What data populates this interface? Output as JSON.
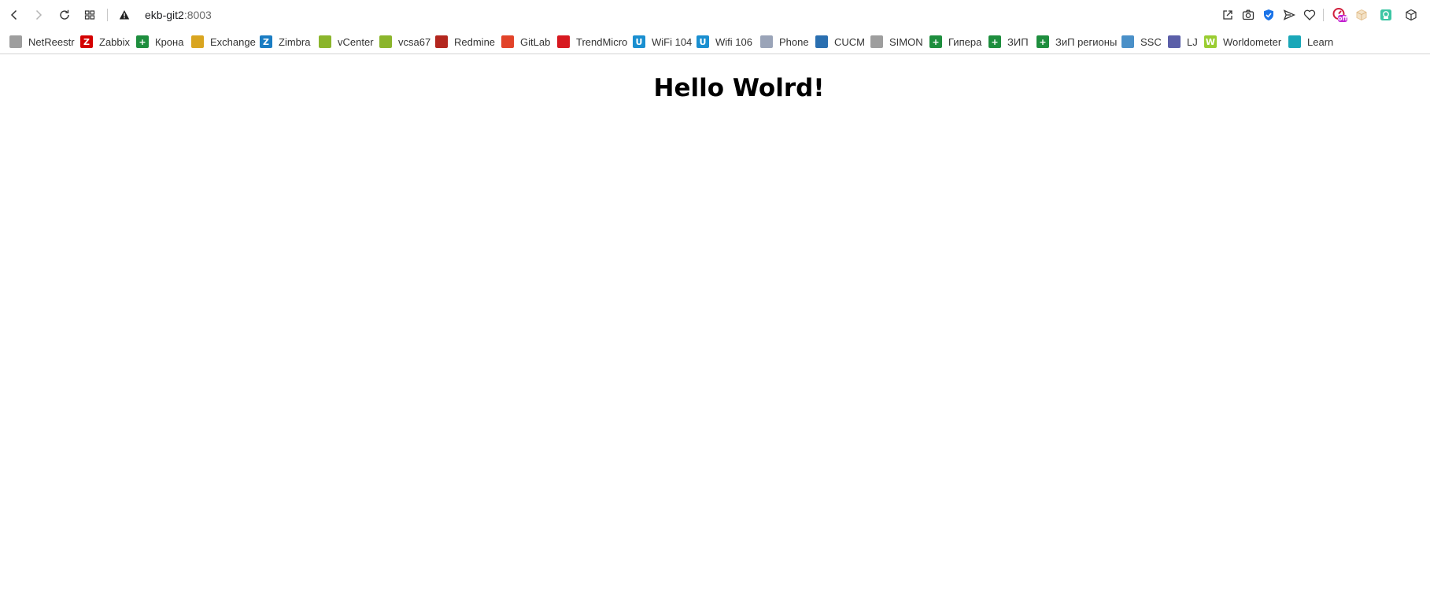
{
  "browser": {
    "url_host": "ekb-git2",
    "url_port": ":8003"
  },
  "icons": {
    "back": "back-arrow-icon",
    "forward": "forward-arrow-icon",
    "reload": "reload-icon",
    "tabs": "tab-grid-icon",
    "security": "not-secure-warning-icon",
    "share": "share-icon",
    "screenshot": "camera-icon",
    "shield": "shield-check-icon",
    "send": "send-icon",
    "favorites": "heart-icon",
    "ext1": "extension-off-icon",
    "ext2": "extension-cube-icon",
    "ext3": "extension-lock-icon",
    "extensions": "extensions-box-icon"
  },
  "extension_badge": "off",
  "bookmarks": [
    {
      "label": "NetReestr",
      "icon_color": "#9e9e9e",
      "glyph": ""
    },
    {
      "label": "Zabbix",
      "icon_color": "#d40000",
      "glyph": "Z"
    },
    {
      "label": "Крона",
      "icon_color": "#1e8e3e",
      "glyph": "+"
    },
    {
      "label": "Exchange",
      "icon_color": "#d9a520",
      "glyph": ""
    },
    {
      "label": "Zimbra",
      "icon_color": "#1a7dc3",
      "glyph": "Z"
    },
    {
      "label": "vCenter",
      "icon_color": "#8bb52c",
      "glyph": ""
    },
    {
      "label": "vcsa67",
      "icon_color": "#8bb52c",
      "glyph": ""
    },
    {
      "label": "Redmine",
      "icon_color": "#b3261e",
      "glyph": ""
    },
    {
      "label": "GitLab",
      "icon_color": "#e24329",
      "glyph": ""
    },
    {
      "label": "TrendMicro",
      "icon_color": "#d71920",
      "glyph": ""
    },
    {
      "label": "WiFi 104",
      "icon_color": "#1a8fd0",
      "glyph": "U"
    },
    {
      "label": "Wifi 106",
      "icon_color": "#1a8fd0",
      "glyph": "U"
    },
    {
      "label": "Phone",
      "icon_color": "#9aa4b8",
      "glyph": ""
    },
    {
      "label": "CUCM",
      "icon_color": "#2a6fb0",
      "glyph": ""
    },
    {
      "label": "SIMON",
      "icon_color": "#9e9e9e",
      "glyph": ""
    },
    {
      "label": "Гипера",
      "icon_color": "#1e8e3e",
      "glyph": "+"
    },
    {
      "label": "ЗИП",
      "icon_color": "#1e8e3e",
      "glyph": "+"
    },
    {
      "label": "ЗиП регионы",
      "icon_color": "#1e8e3e",
      "glyph": "+"
    },
    {
      "label": "SSC",
      "icon_color": "#4a90c8",
      "glyph": ""
    },
    {
      "label": "LJ",
      "icon_color": "#5b5fa8",
      "glyph": ""
    },
    {
      "label": "Worldometer",
      "icon_color": "#9acd32",
      "glyph": "W"
    },
    {
      "label": "Learn",
      "icon_color": "#1aa7b8",
      "glyph": ""
    }
  ],
  "page": {
    "heading": "Hello Wolrd!"
  }
}
